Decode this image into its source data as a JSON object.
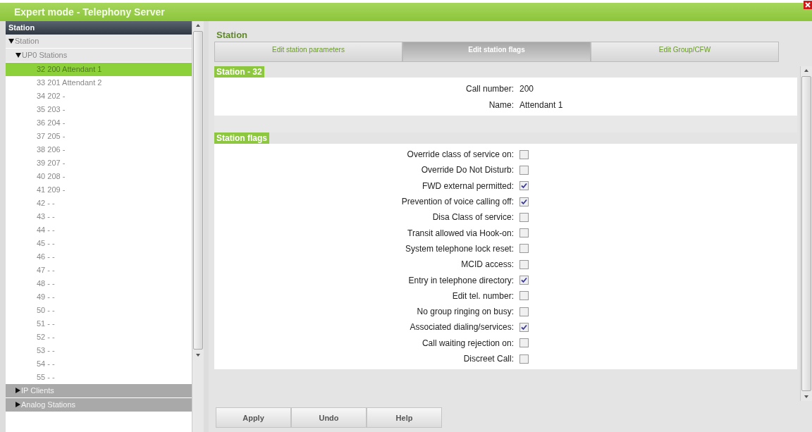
{
  "window": {
    "title": "Expert mode - Telephony Server"
  },
  "sidebar": {
    "header": "Station",
    "tree": [
      {
        "label": "Station",
        "expanded": true,
        "children": [
          {
            "label": "UP0 Stations",
            "expanded": true,
            "children": [
              {
                "label": "32 200 Attendant 1",
                "selected": true
              },
              {
                "label": "33 201 Attendant 2",
                "selected": false
              },
              {
                "label": "34 202 -",
                "selected": false
              },
              {
                "label": "35 203 -",
                "selected": false
              },
              {
                "label": "36 204 -",
                "selected": false
              },
              {
                "label": "37 205 -",
                "selected": false
              },
              {
                "label": "38 206 -",
                "selected": false
              },
              {
                "label": "39 207 -",
                "selected": false
              },
              {
                "label": "40 208 -",
                "selected": false
              },
              {
                "label": "41 209 -",
                "selected": false
              },
              {
                "label": "42 - -",
                "selected": false
              },
              {
                "label": "43 - -",
                "selected": false
              },
              {
                "label": "44 - -",
                "selected": false
              },
              {
                "label": "45 - -",
                "selected": false
              },
              {
                "label": "46 - -",
                "selected": false
              },
              {
                "label": "47 - -",
                "selected": false
              },
              {
                "label": "48 - -",
                "selected": false
              },
              {
                "label": "49 - -",
                "selected": false
              },
              {
                "label": "50 - -",
                "selected": false
              },
              {
                "label": "51 - -",
                "selected": false
              },
              {
                "label": "52 - -",
                "selected": false
              },
              {
                "label": "53 - -",
                "selected": false
              },
              {
                "label": "54 - -",
                "selected": false
              },
              {
                "label": "55 - -",
                "selected": false
              }
            ]
          },
          {
            "label": "IP Clients",
            "expanded": false
          },
          {
            "label": "Analog Stations",
            "expanded": false
          }
        ]
      }
    ]
  },
  "main": {
    "heading": "Station",
    "tabs": [
      {
        "label": "Edit station parameters",
        "selected": false
      },
      {
        "label": "Edit station flags",
        "selected": true
      },
      {
        "label": "Edit Group/CFW",
        "selected": false
      }
    ],
    "station_section": {
      "title": "Station - 32",
      "fields": [
        {
          "label": "Call number:",
          "value": "200"
        },
        {
          "label": "Name:",
          "value": "Attendant 1"
        }
      ]
    },
    "flags_section": {
      "title": "Station flags",
      "flags": [
        {
          "label": "Override class of service on:",
          "checked": false
        },
        {
          "label": "Override Do Not Disturb:",
          "checked": false
        },
        {
          "label": "FWD external permitted:",
          "checked": true
        },
        {
          "label": "Prevention of voice calling off:",
          "checked": true
        },
        {
          "label": "Disa Class of service:",
          "checked": false
        },
        {
          "label": "Transit allowed via Hook-on:",
          "checked": false
        },
        {
          "label": "System telephone lock reset:",
          "checked": false
        },
        {
          "label": "MCID access:",
          "checked": false
        },
        {
          "label": "Entry in telephone directory:",
          "checked": true
        },
        {
          "label": "Edit tel. number:",
          "checked": false
        },
        {
          "label": "No group ringing on busy:",
          "checked": false
        },
        {
          "label": "Associated dialing/services:",
          "checked": true
        },
        {
          "label": "Call waiting rejection on:",
          "checked": false
        },
        {
          "label": "Discreet Call:",
          "checked": false
        }
      ]
    },
    "buttons": [
      "Apply",
      "Undo",
      "Help"
    ]
  }
}
